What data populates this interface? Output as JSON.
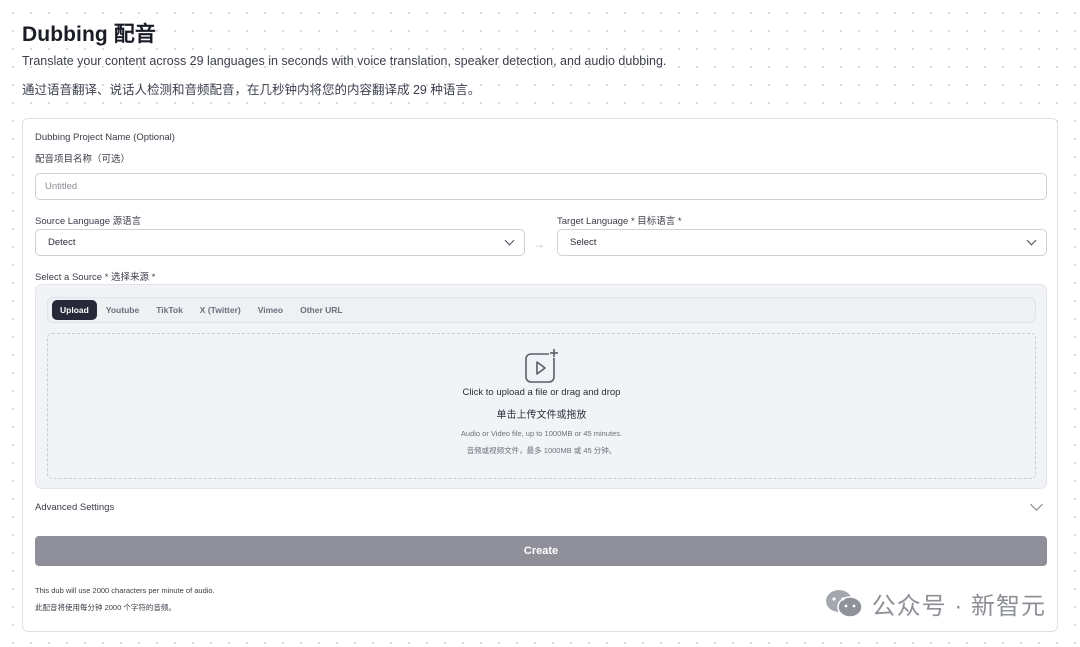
{
  "header": {
    "title": "Dubbing 配音",
    "subtitle_en": "Translate your content across 29 languages in seconds with voice translation, speaker detection, and audio dubbing.",
    "subtitle_zh": "通过语音翻译、说话人检测和音频配音，在几秒钟内将您的内容翻译成 29 种语言。"
  },
  "form": {
    "project_name_label_en": "Dubbing Project Name (Optional)",
    "project_name_label_zh": "配音项目名称（可选）",
    "project_name_placeholder": "Untitled",
    "source_language_label": "Source Language 源语言",
    "source_language_value": "Detect",
    "target_language_label": "Target Language * 目标语言 *",
    "target_language_value": "Select",
    "source_label": "Select a Source * 选择来源 *",
    "source_tabs": [
      "Upload",
      "Youtube",
      "TikTok",
      "X (Twitter)",
      "Vimeo",
      "Other URL"
    ],
    "active_tab": "Upload",
    "dropzone": {
      "title_en": "Click to upload a file or drag and drop",
      "title_zh": "单击上传文件或拖放",
      "hint_en": "Audio or Video file, up to 1000MB or 45 minutes.",
      "hint_zh": "音频或视频文件，最多 1000MB 或 45 分钟。"
    },
    "advanced_settings_label": "Advanced Settings",
    "create_label": "Create",
    "footnote_en": "This dub will use 2000 characters per minute of audio.",
    "footnote_zh": "此配音将使用每分钟 2000 个字符的音频。"
  },
  "watermark": {
    "text": "公众号 · 新智元"
  },
  "colors": {
    "active_tab_bg": "#262939",
    "create_button_bg": "#8f8f99",
    "panel_bg": "#f1f3f7"
  }
}
